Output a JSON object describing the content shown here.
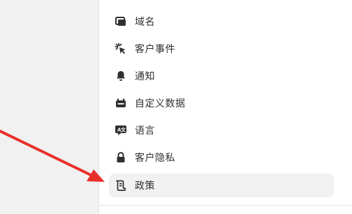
{
  "menu": {
    "items": [
      {
        "label": "域名",
        "icon": "domain-icon"
      },
      {
        "label": "客户事件",
        "icon": "click-icon"
      },
      {
        "label": "通知",
        "icon": "bell-icon"
      },
      {
        "label": "自定义数据",
        "icon": "metafield-icon"
      },
      {
        "label": "语言",
        "icon": "language-icon"
      },
      {
        "label": "客户隐私",
        "icon": "lock-icon"
      },
      {
        "label": "政策",
        "icon": "policy-icon"
      }
    ],
    "active_index": 6
  },
  "annotation": {
    "arrow_color": "#e8302a"
  }
}
